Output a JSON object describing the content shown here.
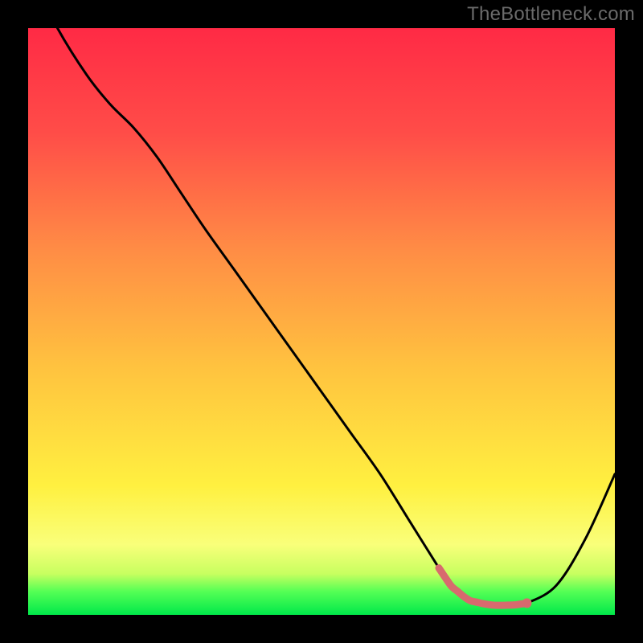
{
  "watermark": "TheBottleneck.com",
  "colors": {
    "background": "#000000",
    "gradient_top": "#ff2a45",
    "gradient_mid_upper": "#ff724a",
    "gradient_mid": "#ffc33f",
    "gradient_mid_lower": "#fff040",
    "gradient_low_band": "#f9ff7a",
    "gradient_green_band": "#55ff55",
    "gradient_bottom": "#00e84a",
    "curve_stroke": "#000000",
    "marker_stroke": "#d86a6e",
    "marker_fill": "#d86a6e"
  },
  "chart_data": {
    "type": "line",
    "title": "",
    "xlabel": "",
    "ylabel": "",
    "xlim": [
      0,
      100
    ],
    "ylim": [
      0,
      100
    ],
    "series": [
      {
        "name": "bottleneck-curve",
        "x": [
          0,
          5,
          10,
          14,
          18,
          22,
          26,
          30,
          35,
          40,
          45,
          50,
          55,
          60,
          65,
          70,
          72,
          75,
          78,
          80,
          83,
          85,
          90,
          95,
          100
        ],
        "values": [
          110,
          100,
          92,
          87,
          83,
          78,
          72,
          66,
          59,
          52,
          45,
          38,
          31,
          24,
          16,
          8,
          5,
          2.5,
          1.8,
          1.6,
          1.7,
          2.0,
          5,
          13,
          24
        ]
      }
    ],
    "marker_band": {
      "description": "highlighted near-zero bottleneck region",
      "x_start": 70,
      "x_end": 85,
      "y_approx": 1.8,
      "end_dot_x": 85,
      "end_dot_y": 2.0
    },
    "gradient_stops_pct": [
      {
        "offset": 0,
        "color": "#ff2a45"
      },
      {
        "offset": 18,
        "color": "#ff4d48"
      },
      {
        "offset": 38,
        "color": "#ff8d45"
      },
      {
        "offset": 58,
        "color": "#ffc33f"
      },
      {
        "offset": 78,
        "color": "#fff040"
      },
      {
        "offset": 88,
        "color": "#f9ff7a"
      },
      {
        "offset": 93,
        "color": "#c8ff60"
      },
      {
        "offset": 96,
        "color": "#55ff55"
      },
      {
        "offset": 100,
        "color": "#00e84a"
      }
    ]
  }
}
